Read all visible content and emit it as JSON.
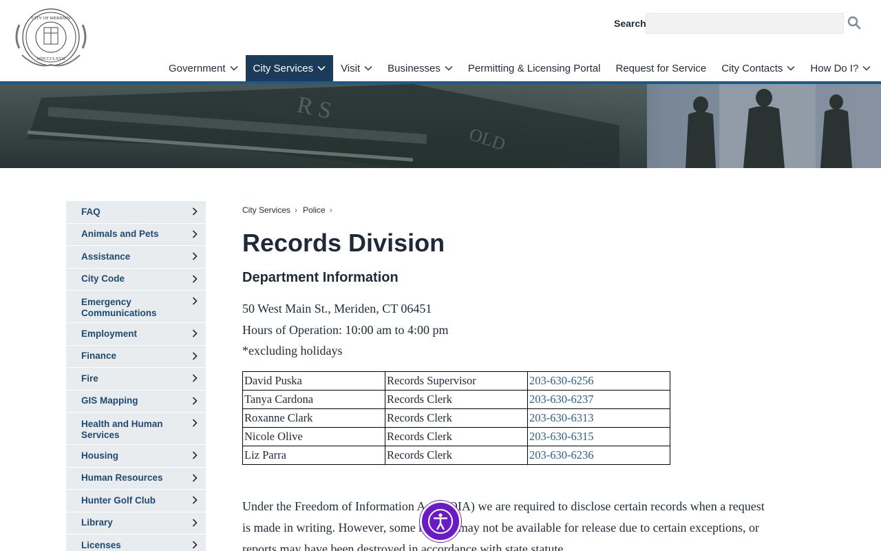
{
  "header": {
    "logo_alt": "City of Meriden seal",
    "logo_text_top": "CITY OF MERIDEN",
    "logo_text_bottom": "MDCCCLXVII",
    "search": {
      "label": "Search",
      "placeholder": "",
      "value": ""
    }
  },
  "nav": {
    "items": [
      {
        "label": "Government",
        "has_dropdown": true,
        "active": false
      },
      {
        "label": "City Services",
        "has_dropdown": true,
        "active": true
      },
      {
        "label": "Visit",
        "has_dropdown": true,
        "active": false
      },
      {
        "label": "Businesses",
        "has_dropdown": true,
        "active": false
      },
      {
        "label": "Permitting & Licensing Portal",
        "has_dropdown": false,
        "active": false
      },
      {
        "label": "Request for Service",
        "has_dropdown": false,
        "active": false
      },
      {
        "label": "City Contacts",
        "has_dropdown": true,
        "active": false
      },
      {
        "label": "How Do I?",
        "has_dropdown": true,
        "active": false
      }
    ]
  },
  "sidebar": {
    "items": [
      "FAQ",
      "Animals and Pets",
      "Assistance",
      "City Code",
      "Emergency Communications",
      "Employment",
      "Finance",
      "Fire",
      "GIS Mapping",
      "Health and Human Services",
      "Housing",
      "Human Resources",
      "Hunter Golf Club",
      "Library",
      "Licenses"
    ]
  },
  "breadcrumb": {
    "items": [
      "City Services",
      "Police"
    ],
    "separator": "›"
  },
  "main": {
    "title": "Records Division",
    "section_title": "Department Information",
    "address": "50 West Main St., Meriden, CT 06451",
    "hours": "Hours of Operation: 10:00 am to 4:00 pm",
    "note": "*excluding holidays",
    "staff": [
      {
        "name": "David Puska",
        "role": "Records Supervisor",
        "phone": "203-630-6256"
      },
      {
        "name": "Tanya Cardona",
        "role": "Records Clerk",
        "phone": "203-630-6237"
      },
      {
        "name": "Roxanne Clark",
        "role": "Records Clerk",
        "phone": "203-630-6313"
      },
      {
        "name": "Nicole Olive",
        "role": "Records Clerk",
        "phone": "203-630-6315"
      },
      {
        "name": "Liz Parra",
        "role": "Records Clerk",
        "phone": "203-630-6236"
      }
    ],
    "body_line_1": "Under the Freedom of Information Act (FOIA) we are required to disclose certain records when a request",
    "body_line_2": "is made in writing. However, some records may not be available for release due to certain exceptions, or",
    "body_line_3": "reports may have been destroyed in accordance with state statute."
  },
  "accessibility_button": {
    "icon": "accessibility-icon",
    "color": "#6a1bc4"
  },
  "colors": {
    "nav_active": "#1c3a5a",
    "sidebar_bg": "#e8ecee",
    "link": "#2a5f8a",
    "sidebar_link": "#1e4a72"
  }
}
